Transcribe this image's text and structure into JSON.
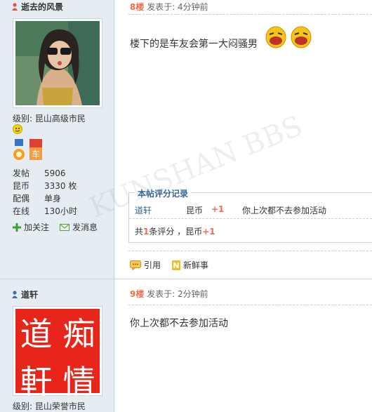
{
  "post1": {
    "author": "逝去的风景",
    "level_label": "级别: 昆山高级市民",
    "stats": [
      {
        "key": "发帖",
        "value": "5906"
      },
      {
        "key": "昆币",
        "value": "3330 枚"
      },
      {
        "key": "配偶",
        "value": "单身"
      },
      {
        "key": "在线",
        "value": "130小时"
      }
    ],
    "add_follow": "加关注",
    "send_msg": "发消息",
    "floor": "8楼",
    "time": "发表于: 4分钟前",
    "content": "楼下的是车友会第一大闷骚男",
    "rating": {
      "title": "本帖评分记录",
      "user": "道轩",
      "currency": "昆币",
      "score": "+1",
      "reason": "你上次都不去参加活动",
      "summary_prefix": "共",
      "summary_count": "1",
      "summary_mid": "条评分 ，昆币",
      "summary_score": "+1"
    },
    "quote": "引用",
    "new_thing": "新鲜事"
  },
  "post2": {
    "author": "道轩",
    "avatar_chars": [
      "痴",
      "道",
      "情",
      "軒"
    ],
    "level_label": "级别: 昆山荣誉市民",
    "floor": "9楼",
    "time": "发表于: 2分钟前",
    "content": "你上次都不去参加活动"
  },
  "watermark": "KUNSHAN BBS",
  "colors": {
    "sidebar": "#e5edf2",
    "accent": "#f26c4f",
    "border": "#c2d5e3"
  }
}
